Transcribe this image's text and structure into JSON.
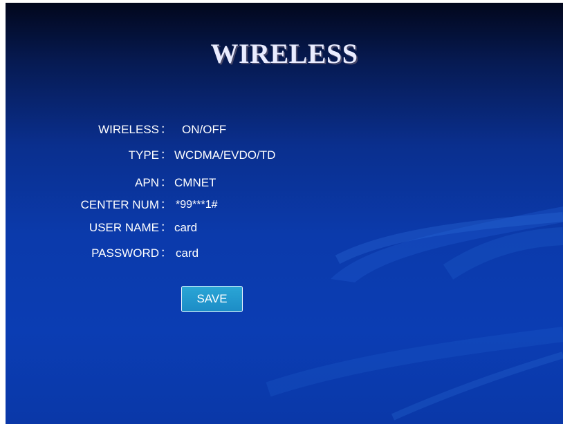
{
  "title": "WIRELESS",
  "separator": "：",
  "fields": [
    {
      "label": "WIRELESS",
      "value": "ON/OFF"
    },
    {
      "label": "TYPE",
      "value": "WCDMA/EVDO/TD"
    },
    {
      "label": "APN",
      "value": "CMNET"
    },
    {
      "label": "CENTER NUM",
      "value": "*99***1#"
    },
    {
      "label": "USER NAME",
      "value": "card"
    },
    {
      "label": "PASSWORD",
      "value": "card"
    }
  ],
  "save_label": "SAVE",
  "colors": {
    "background_top": "#02071c",
    "background_main": "#0b3aab",
    "button": "#1c8cc6",
    "text": "#ffffff"
  }
}
